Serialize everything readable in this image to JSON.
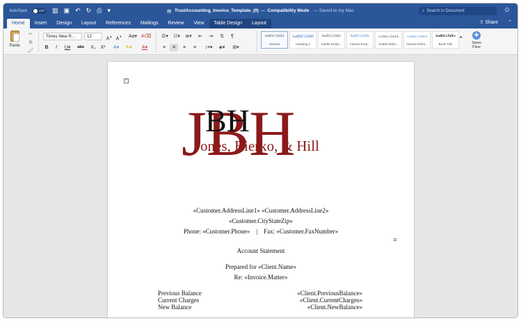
{
  "titlebar": {
    "autosave_label": "AutoSave",
    "autosave_state": "OFF",
    "doc_name": "TrustAccounting_Invoice_Template_(9)",
    "separator": "—",
    "mode": "Compatibility Mode",
    "saved_status": "— Saved to my Mac",
    "search_placeholder": "Search in Document"
  },
  "ribbon_tabs": [
    "Home",
    "Insert",
    "Design",
    "Layout",
    "References",
    "Mailings",
    "Review",
    "View",
    "Table Design",
    "Layout"
  ],
  "share_label": "Share",
  "ribbon": {
    "paste_label": "Paste",
    "font_name": "Times New R...",
    "font_size": "12",
    "pane_label_1": "Styles",
    "pane_label_2": "Pane",
    "styles": [
      {
        "sample": "AaBbCcDdEe",
        "name": "Normal"
      },
      {
        "sample": "AaBbCcDdE",
        "name": "Heading 2"
      },
      {
        "sample": "AaBbCcDdEe",
        "name": "Subtle Emph..."
      },
      {
        "sample": "AaBbCcDdEe",
        "name": "Intense Emp..."
      },
      {
        "sample": "AABBCCDDEE",
        "name": "Subtle Refer..."
      },
      {
        "sample": "AABBCCDDEE",
        "name": "Intense Refer..."
      },
      {
        "sample": "AaBbCcDdEe",
        "name": "Book Title"
      }
    ]
  },
  "document": {
    "logo": {
      "big": "JBH",
      "line": "ones, Bierko, & Hill",
      "color_red": "#8b1a1a"
    },
    "address": "«Customer.AddressLine1» «Customer.AddressLine2»",
    "city": "«Customer.CityStateZip»",
    "phone_line": "Phone: «Customer.Phone»    |    Fax: «Customer.FaxNumber»",
    "statement_title": "Account Statement",
    "prepared_for": "Prepared for «Client.Name»",
    "re_line": "Re: «Invoice.Matter»",
    "balances": [
      {
        "label": "Previous Balance",
        "value": "«Client.PreviousBalance»"
      },
      {
        "label": "Current Charges",
        "value": "«Client.CurrentCharges»"
      },
      {
        "label": "New Balance",
        "value": "«Client.NewBalance»"
      }
    ]
  }
}
